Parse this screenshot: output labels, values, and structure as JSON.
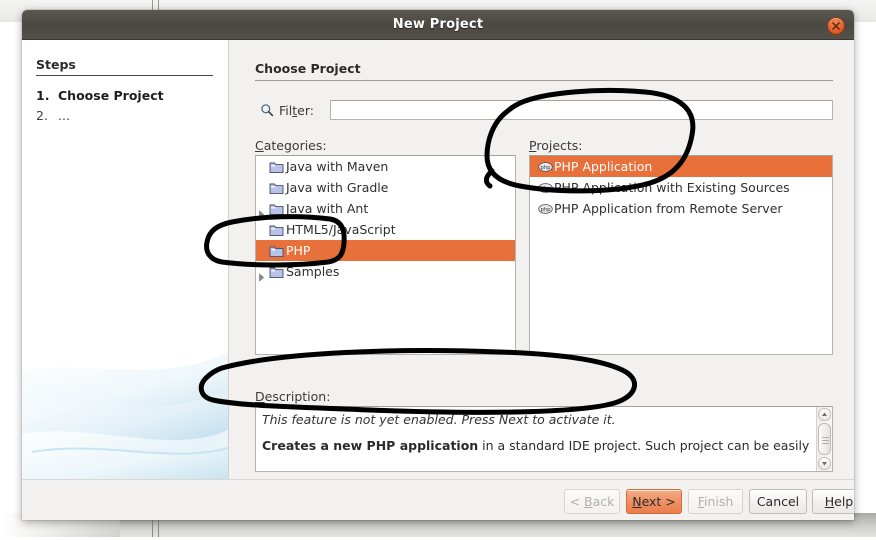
{
  "window": {
    "title": "New Project",
    "close_icon": "close-icon"
  },
  "steps": {
    "heading": "Steps",
    "items": [
      {
        "num": "1.",
        "label": "Choose Project",
        "state": "current"
      },
      {
        "num": "2.",
        "label": "...",
        "state": "pending"
      }
    ]
  },
  "content": {
    "title": "Choose Project",
    "filter": {
      "icon": "search-icon",
      "label_before": "Fil",
      "label_mnemonic": "t",
      "label_after": "er:",
      "value": "",
      "placeholder": ""
    },
    "categories": {
      "caption_mnemonic": "C",
      "caption_rest": "ategories:",
      "items": [
        {
          "label": "Java with Maven",
          "icon": "folder-icon",
          "expandable": false,
          "selected": false
        },
        {
          "label": "Java with Gradle",
          "icon": "folder-icon",
          "expandable": false,
          "selected": false
        },
        {
          "label": "Java with Ant",
          "icon": "folder-icon",
          "expandable": true,
          "selected": false
        },
        {
          "label": "HTML5/JavaScript",
          "icon": "folder-icon",
          "expandable": false,
          "selected": false
        },
        {
          "label": "PHP",
          "icon": "folder-icon",
          "expandable": false,
          "selected": true
        },
        {
          "label": "Samples",
          "icon": "folder-icon",
          "expandable": true,
          "selected": false
        }
      ]
    },
    "projects": {
      "caption_mnemonic": "P",
      "caption_rest": "rojects:",
      "items": [
        {
          "label": "PHP Application",
          "icon": "php-icon",
          "selected": true
        },
        {
          "label": "PHP Application with Existing Sources",
          "icon": "php-icon",
          "selected": false
        },
        {
          "label": "PHP Application from Remote Server",
          "icon": "php-icon",
          "selected": false
        }
      ]
    },
    "description": {
      "caption_mnemonic": "D",
      "caption_rest": "escription:",
      "note": "This feature is not yet enabled. Press Next to activate it.",
      "body_bold": "Creates a new PHP application",
      "body_rest": " in a standard IDE project. Such project can be easily"
    }
  },
  "footer": {
    "buttons": [
      {
        "id": "back",
        "prefix": "< ",
        "mnemonic": "B",
        "suffix": "ack",
        "state": "disabled"
      },
      {
        "id": "next",
        "prefix": "",
        "mnemonic": "N",
        "suffix": "ext >",
        "state": "primary"
      },
      {
        "id": "finish",
        "prefix": "",
        "mnemonic": "F",
        "suffix": "inish",
        "state": "disabled"
      },
      {
        "id": "cancel",
        "prefix": "",
        "mnemonic": "",
        "suffix": "Cancel",
        "state": "normal"
      },
      {
        "id": "help",
        "prefix": "",
        "mnemonic": "H",
        "suffix": "elp",
        "state": "normal"
      }
    ]
  },
  "colors": {
    "selection_orange": "#e8703a",
    "titlebar_dark": "#4b4842",
    "close_orange": "#e2642f",
    "annotation_ink": "#000000"
  },
  "annotations": [
    {
      "name": "ink-circle-projects",
      "target": "projects-caption-and-first-item"
    },
    {
      "name": "ink-circle-php-category",
      "target": "categories-php-row"
    },
    {
      "name": "ink-circle-description",
      "target": "description-note"
    }
  ]
}
